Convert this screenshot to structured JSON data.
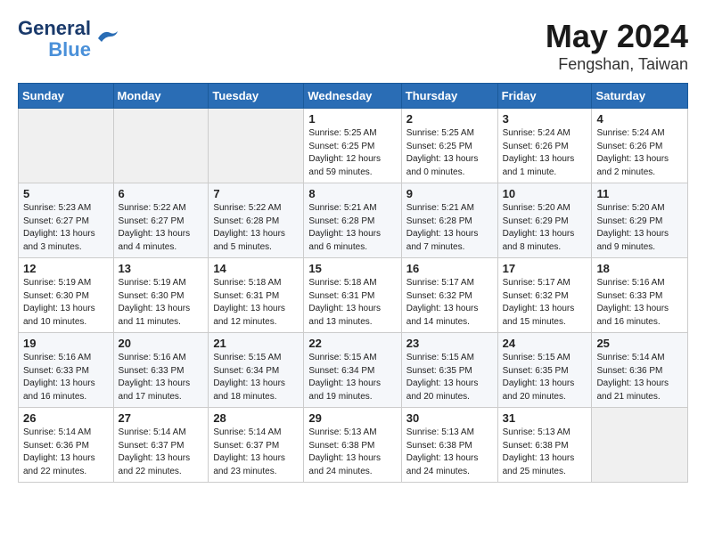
{
  "logo": {
    "line1": "General",
    "line2": "Blue"
  },
  "title": "May 2024",
  "location": "Fengshan, Taiwan",
  "weekdays": [
    "Sunday",
    "Monday",
    "Tuesday",
    "Wednesday",
    "Thursday",
    "Friday",
    "Saturday"
  ],
  "weeks": [
    [
      {
        "day": "",
        "info": ""
      },
      {
        "day": "",
        "info": ""
      },
      {
        "day": "",
        "info": ""
      },
      {
        "day": "1",
        "info": "Sunrise: 5:25 AM\nSunset: 6:25 PM\nDaylight: 12 hours\nand 59 minutes."
      },
      {
        "day": "2",
        "info": "Sunrise: 5:25 AM\nSunset: 6:25 PM\nDaylight: 13 hours\nand 0 minutes."
      },
      {
        "day": "3",
        "info": "Sunrise: 5:24 AM\nSunset: 6:26 PM\nDaylight: 13 hours\nand 1 minute."
      },
      {
        "day": "4",
        "info": "Sunrise: 5:24 AM\nSunset: 6:26 PM\nDaylight: 13 hours\nand 2 minutes."
      }
    ],
    [
      {
        "day": "5",
        "info": "Sunrise: 5:23 AM\nSunset: 6:27 PM\nDaylight: 13 hours\nand 3 minutes."
      },
      {
        "day": "6",
        "info": "Sunrise: 5:22 AM\nSunset: 6:27 PM\nDaylight: 13 hours\nand 4 minutes."
      },
      {
        "day": "7",
        "info": "Sunrise: 5:22 AM\nSunset: 6:28 PM\nDaylight: 13 hours\nand 5 minutes."
      },
      {
        "day": "8",
        "info": "Sunrise: 5:21 AM\nSunset: 6:28 PM\nDaylight: 13 hours\nand 6 minutes."
      },
      {
        "day": "9",
        "info": "Sunrise: 5:21 AM\nSunset: 6:28 PM\nDaylight: 13 hours\nand 7 minutes."
      },
      {
        "day": "10",
        "info": "Sunrise: 5:20 AM\nSunset: 6:29 PM\nDaylight: 13 hours\nand 8 minutes."
      },
      {
        "day": "11",
        "info": "Sunrise: 5:20 AM\nSunset: 6:29 PM\nDaylight: 13 hours\nand 9 minutes."
      }
    ],
    [
      {
        "day": "12",
        "info": "Sunrise: 5:19 AM\nSunset: 6:30 PM\nDaylight: 13 hours\nand 10 minutes."
      },
      {
        "day": "13",
        "info": "Sunrise: 5:19 AM\nSunset: 6:30 PM\nDaylight: 13 hours\nand 11 minutes."
      },
      {
        "day": "14",
        "info": "Sunrise: 5:18 AM\nSunset: 6:31 PM\nDaylight: 13 hours\nand 12 minutes."
      },
      {
        "day": "15",
        "info": "Sunrise: 5:18 AM\nSunset: 6:31 PM\nDaylight: 13 hours\nand 13 minutes."
      },
      {
        "day": "16",
        "info": "Sunrise: 5:17 AM\nSunset: 6:32 PM\nDaylight: 13 hours\nand 14 minutes."
      },
      {
        "day": "17",
        "info": "Sunrise: 5:17 AM\nSunset: 6:32 PM\nDaylight: 13 hours\nand 15 minutes."
      },
      {
        "day": "18",
        "info": "Sunrise: 5:16 AM\nSunset: 6:33 PM\nDaylight: 13 hours\nand 16 minutes."
      }
    ],
    [
      {
        "day": "19",
        "info": "Sunrise: 5:16 AM\nSunset: 6:33 PM\nDaylight: 13 hours\nand 16 minutes."
      },
      {
        "day": "20",
        "info": "Sunrise: 5:16 AM\nSunset: 6:33 PM\nDaylight: 13 hours\nand 17 minutes."
      },
      {
        "day": "21",
        "info": "Sunrise: 5:15 AM\nSunset: 6:34 PM\nDaylight: 13 hours\nand 18 minutes."
      },
      {
        "day": "22",
        "info": "Sunrise: 5:15 AM\nSunset: 6:34 PM\nDaylight: 13 hours\nand 19 minutes."
      },
      {
        "day": "23",
        "info": "Sunrise: 5:15 AM\nSunset: 6:35 PM\nDaylight: 13 hours\nand 20 minutes."
      },
      {
        "day": "24",
        "info": "Sunrise: 5:15 AM\nSunset: 6:35 PM\nDaylight: 13 hours\nand 20 minutes."
      },
      {
        "day": "25",
        "info": "Sunrise: 5:14 AM\nSunset: 6:36 PM\nDaylight: 13 hours\nand 21 minutes."
      }
    ],
    [
      {
        "day": "26",
        "info": "Sunrise: 5:14 AM\nSunset: 6:36 PM\nDaylight: 13 hours\nand 22 minutes."
      },
      {
        "day": "27",
        "info": "Sunrise: 5:14 AM\nSunset: 6:37 PM\nDaylight: 13 hours\nand 22 minutes."
      },
      {
        "day": "28",
        "info": "Sunrise: 5:14 AM\nSunset: 6:37 PM\nDaylight: 13 hours\nand 23 minutes."
      },
      {
        "day": "29",
        "info": "Sunrise: 5:13 AM\nSunset: 6:38 PM\nDaylight: 13 hours\nand 24 minutes."
      },
      {
        "day": "30",
        "info": "Sunrise: 5:13 AM\nSunset: 6:38 PM\nDaylight: 13 hours\nand 24 minutes."
      },
      {
        "day": "31",
        "info": "Sunrise: 5:13 AM\nSunset: 6:38 PM\nDaylight: 13 hours\nand 25 minutes."
      },
      {
        "day": "",
        "info": ""
      }
    ]
  ]
}
